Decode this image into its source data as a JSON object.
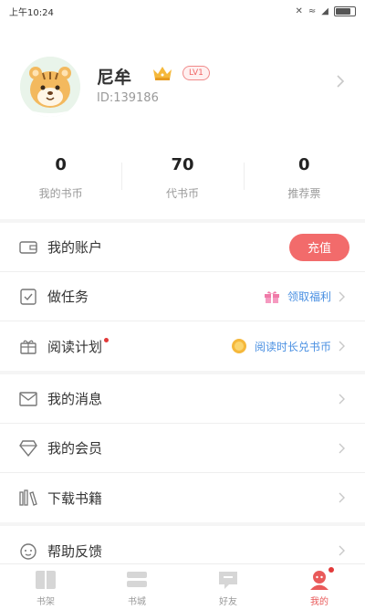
{
  "status_bar": {
    "time": "上午10:24"
  },
  "profile": {
    "name": "尼牟",
    "level": "LV1",
    "user_id": "ID:139186"
  },
  "stats": [
    {
      "value": "0",
      "label": "我的书币"
    },
    {
      "value": "70",
      "label": "代书币"
    },
    {
      "value": "0",
      "label": "推荐票"
    }
  ],
  "menu": {
    "account": {
      "label": "我的账户",
      "action": "充值"
    },
    "tasks": {
      "label": "做任务",
      "action": "领取福利"
    },
    "reading_plan": {
      "label": "阅读计划",
      "action": "阅读时长兑书币"
    },
    "messages": {
      "label": "我的消息"
    },
    "membership": {
      "label": "我的会员"
    },
    "downloads": {
      "label": "下载书籍"
    },
    "help": {
      "label": "帮助反馈"
    }
  },
  "tabbar": {
    "tabs": [
      {
        "label": "书架",
        "icon": "bookshelf-icon"
      },
      {
        "label": "书城",
        "icon": "bookstore-icon"
      },
      {
        "label": "好友",
        "icon": "friends-icon"
      },
      {
        "label": "我的",
        "icon": "me-icon",
        "active": true
      }
    ]
  },
  "colors": {
    "accent": "#f26b6b",
    "link": "#4a90e2"
  }
}
